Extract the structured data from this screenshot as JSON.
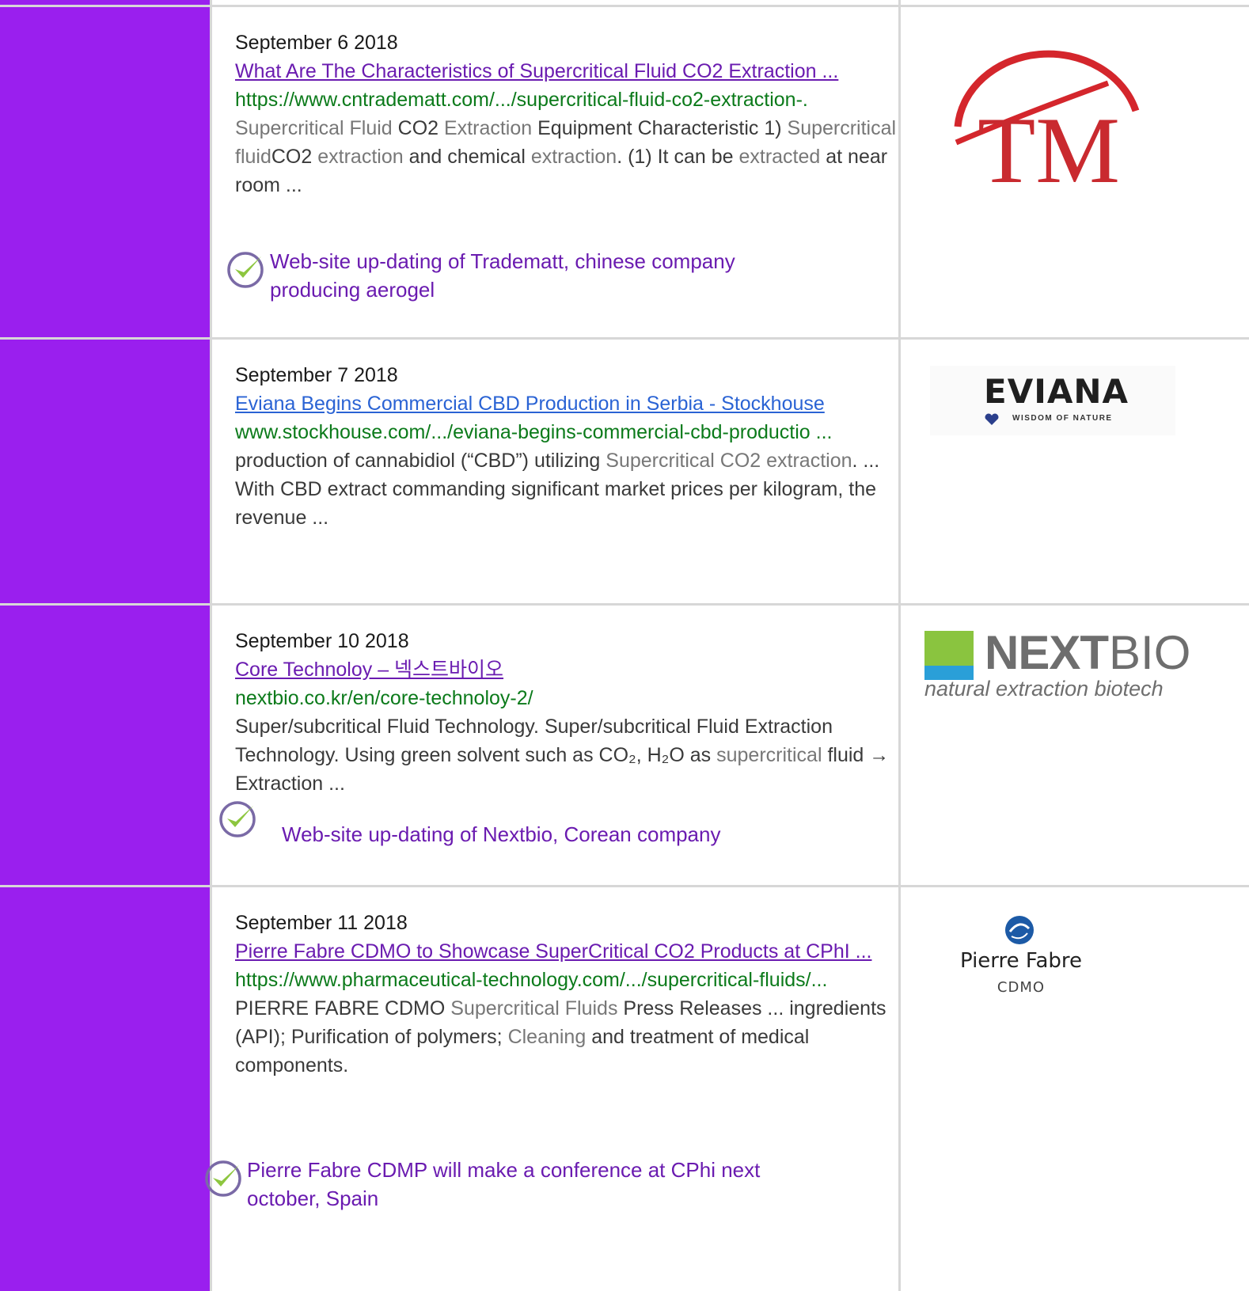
{
  "entries": [
    {
      "date": "September 6 2018",
      "title": "What Are The Characteristics of Supercritical Fluid CO2 Extraction ...",
      "url": "https://www.cntradematt.com/.../supercritical-fluid-co2-extraction-.",
      "snippet": [
        {
          "t": "Supercritical Fluid ",
          "g": true
        },
        {
          "t": "CO2 ",
          "g": false
        },
        {
          "t": "Extraction ",
          "g": true
        },
        {
          "t": "Equipment Characteristic 1) ",
          "g": false
        },
        {
          "t": "Supercritical fluid",
          "g": true
        },
        {
          "t": "CO2 ",
          "g": false
        },
        {
          "t": "extraction ",
          "g": true
        },
        {
          "t": "and chemical ",
          "g": false
        },
        {
          "t": "extraction",
          "g": true
        },
        {
          "t": ". (1) It can be ",
          "g": false
        },
        {
          "t": "extracted ",
          "g": true
        },
        {
          "t": "at near room ...",
          "g": false
        }
      ],
      "note": "Web-site up-dating of Tradematt, chinese company producing aerogel",
      "logo": {
        "name": "TM",
        "text": "TM"
      }
    },
    {
      "date": "September 7 2018",
      "title": "Eviana Begins Commercial CBD Production in Serbia - Stockhouse",
      "url": "www.stockhouse.com/.../eviana-begins-commercial-cbd-productio ...",
      "snippet": [
        {
          "t": "production of cannabidiol (“CBD”) utilizing ",
          "g": false
        },
        {
          "t": "Supercritical CO2 extraction",
          "g": true
        },
        {
          "t": ". ... With CBD extract commanding significant market prices per kilogram, the revenue ...",
          "g": false
        }
      ],
      "note": "",
      "logo": {
        "name": "EVIANA",
        "text": "EVIANA",
        "tagline": "WISDOM OF NATURE"
      }
    },
    {
      "date": "September 10 2018",
      "title": "Core Technoloy – 넥스트바이오",
      "url": "nextbio.co.kr/en/core-technoloy-2/",
      "snippet": [
        {
          "t": "Super/subcritical Fluid Technology. Super/subcritical Fluid Extraction Technology. Using green solvent such as CO₂, H₂O as ",
          "g": false
        },
        {
          "t": "supercritical ",
          "g": true
        },
        {
          "t": "fluid → Extraction ...",
          "g": false
        }
      ],
      "note": "Web-site up-dating of Nextbio, Corean company",
      "logo": {
        "name": "NEXTBIO",
        "text_bold": "NEXT",
        "text_light": "BIO",
        "tagline": "natural extraction biotech"
      }
    },
    {
      "date": "September 11 2018",
      "title": "Pierre Fabre CDMO to Showcase SuperCritical CO2 Products at CPhI ...",
      "url": "https://www.pharmaceutical-technology.com/.../supercritical-fluids/...",
      "snippet": [
        {
          "t": " PIERRE FABRE CDMO ",
          "g": false
        },
        {
          "t": "Supercritical Fluids ",
          "g": true
        },
        {
          "t": "Press Releases ... ingredients (API); Purification of polymers; ",
          "g": false
        },
        {
          "t": "Cleaning ",
          "g": true
        },
        {
          "t": "and treatment of medical components.",
          "g": false
        }
      ],
      "note": "Pierre Fabre CDMP will make a conference at CPhi next october, Spain",
      "logo": {
        "name": "Pierre Fabre",
        "text": "Pierre Fabre",
        "tagline": "CDMO"
      }
    }
  ],
  "colors": {
    "sidebar": "#9a1fee",
    "title_link": "#6a1bb0",
    "title_link_visited_blue": "#2a63d4",
    "url": "#0b7a1a",
    "note": "#6a1bb0",
    "check_green": "#8dc63f",
    "check_ring": "#7a6aa6"
  }
}
